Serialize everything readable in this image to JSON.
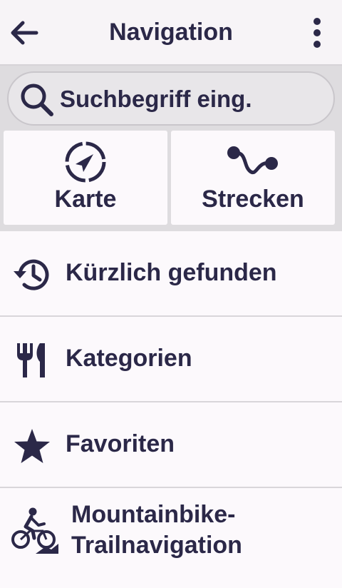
{
  "header": {
    "title": "Navigation",
    "back_icon": "arrow-left-icon",
    "menu_icon": "more-vertical-icon"
  },
  "search": {
    "placeholder": "Suchbegriff eing.",
    "icon": "search-icon"
  },
  "tiles": [
    {
      "label": "Karte",
      "icon": "compass-arrow-icon"
    },
    {
      "label": "Strecken",
      "icon": "route-icon"
    }
  ],
  "list": [
    {
      "label": "Kürzlich gefunden",
      "icon": "history-icon"
    },
    {
      "label": "Kategorien",
      "icon": "fork-knife-icon"
    },
    {
      "label": "Favoriten",
      "icon": "star-icon"
    },
    {
      "label_line1": "Mountainbike-",
      "label_line2": "Trailnavigation",
      "icon": "mountain-bike-icon"
    }
  ],
  "colors": {
    "text": "#2b2848",
    "background": "#fcf9fc",
    "band": "#dedcdf",
    "divider": "#d9d6da"
  }
}
